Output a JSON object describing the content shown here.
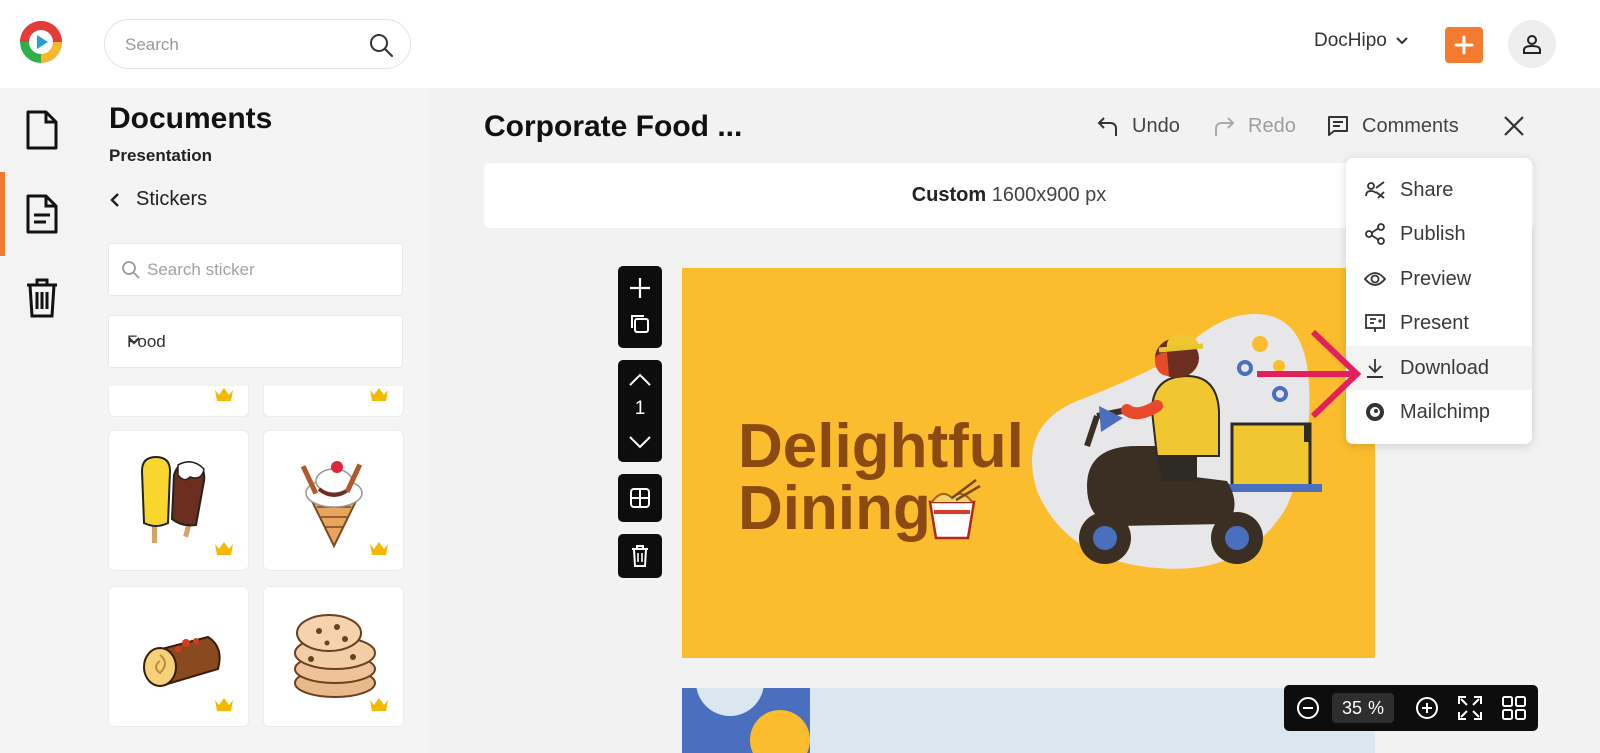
{
  "header": {
    "search_placeholder": "Search",
    "workspace": "DocHipo",
    "accent_color": "#f57b30"
  },
  "leftnav": {
    "items": [
      {
        "name": "documents-icon"
      },
      {
        "name": "my-documents-icon",
        "active": true
      },
      {
        "name": "trash-icon"
      }
    ]
  },
  "panel": {
    "title": "Documents",
    "subtitle": "Presentation",
    "back_label": "Stickers",
    "search_placeholder": "Search sticker",
    "category": "Food",
    "stickers": [
      {
        "name": "partial-sticker",
        "premium": true
      },
      {
        "name": "partial-sticker",
        "premium": true
      },
      {
        "name": "popsicles-sticker",
        "premium": true
      },
      {
        "name": "ice-cream-cone-sticker",
        "premium": true
      },
      {
        "name": "swiss-roll-sticker",
        "premium": true
      },
      {
        "name": "cookies-sticker",
        "premium": true
      }
    ]
  },
  "editor": {
    "doc_title": "Corporate Food ...",
    "undo": "Undo",
    "redo": "Redo",
    "comments": "Comments",
    "size_label": "Custom",
    "size_value": "1600x900 px",
    "page_number": "1",
    "slide_heading_line1": "Delightful",
    "slide_heading_line2": "Dining",
    "slide_bg": "#fbbd2e"
  },
  "share_menu": {
    "items": [
      {
        "label": "Share",
        "icon": "share-icon"
      },
      {
        "label": "Publish",
        "icon": "publish-icon"
      },
      {
        "label": "Preview",
        "icon": "eye-icon"
      },
      {
        "label": "Present",
        "icon": "present-icon"
      },
      {
        "label": "Download",
        "icon": "download-icon",
        "highlighted": true
      },
      {
        "label": "Mailchimp",
        "icon": "mailchimp-icon"
      }
    ]
  },
  "zoom": {
    "value": "35",
    "unit": "%"
  }
}
